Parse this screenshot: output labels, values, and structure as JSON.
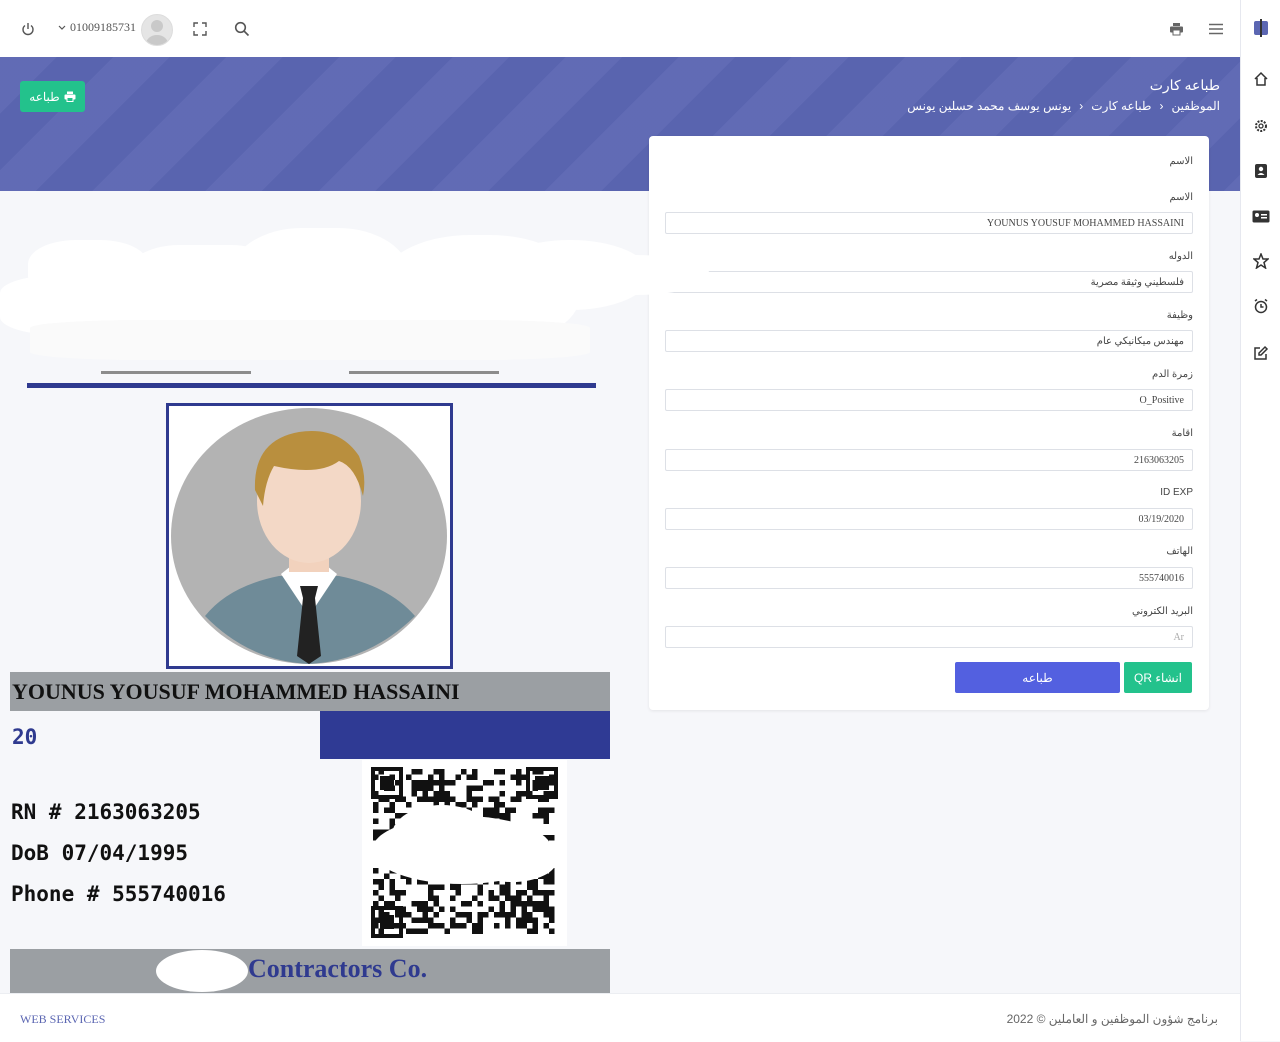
{
  "topbar": {
    "user_phone": "01009185731",
    "icons": [
      "power-icon",
      "chevron-down-icon",
      "avatar",
      "fullscreen-icon",
      "search-icon",
      "printer-icon",
      "menu-icon"
    ]
  },
  "sidebar": {
    "icons": [
      "sidebar-toggle-icon",
      "home-icon",
      "gear-icon",
      "contact-icon",
      "id-card-icon",
      "star-icon",
      "alarm-icon",
      "edit-icon"
    ]
  },
  "header": {
    "title": "طباعه كارت",
    "breadcrumb": [
      "الموظفين",
      "طباعه كارت",
      "يونس يوسف محمد حسلين يونس"
    ],
    "print_button": "طباعه"
  },
  "form": {
    "section_label": "الاسم",
    "fields": [
      {
        "label": "الاسم",
        "value": "YOUNUS YOUSUF MOHAMMED HASSAINI"
      },
      {
        "label": "الدوله",
        "value": "فلسطيني وثيقة مصرية"
      },
      {
        "label": "وظيفة",
        "value": "مهندس ميكانيكي عام"
      },
      {
        "label": "زمرة الدم",
        "value": "O_Positive"
      },
      {
        "label": "اقامة",
        "value": "2163063205"
      },
      {
        "label": "ID EXP",
        "value": "03/19/2020"
      },
      {
        "label": "الهاتف",
        "value": "555740016"
      },
      {
        "label": "البريد الكتروني",
        "value": "Ar"
      }
    ],
    "print_label": "طباعه",
    "qr_label": "QR انشاء"
  },
  "id_card": {
    "name": "YOUNUS YOUSUF MOHAMMED HASSAINI",
    "age": "20",
    "rn": "RN # 2163063205",
    "dob": "DoB 07/04/1995",
    "phone": "Phone # 555740016",
    "company": "Contractors Co."
  },
  "footer": {
    "left": "WEB SERVICES",
    "right": "2022 © برنامج شؤون الموظفين و العاملين"
  },
  "colors": {
    "header": "#5b66b2",
    "green": "#23c28c",
    "primary": "#5360e0",
    "navy": "#2f3a8f",
    "gray_bar": "#9b9fa3"
  }
}
